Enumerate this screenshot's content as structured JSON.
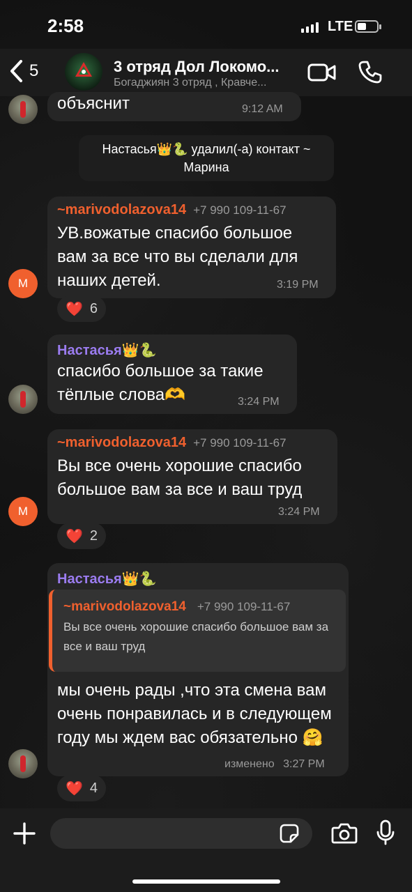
{
  "status": {
    "time": "2:58",
    "network": "LTE"
  },
  "header": {
    "back_count": "5",
    "title": "3 отряд Дол Локомо...",
    "subtitle": "Богаджиян 3 отряд , Кравче..."
  },
  "messages": [
    {
      "text": "объяснит",
      "time": "9:12 AM"
    },
    {
      "system": "Настасья👑🐍 удалил(-а) контакт ~ Марина"
    },
    {
      "sender": "~marivodolazova14",
      "phone": "+7 990 109-11-67",
      "text": "УВ.вожатые спасибо большое вам за все что вы сделали для наших детей.",
      "time": "3:19 PM",
      "avatar_initial": "M",
      "reaction": "6"
    },
    {
      "sender": "Настасья👑🐍",
      "text": "спасибо большое за такие тёплые слова🫶",
      "time": "3:24 PM"
    },
    {
      "sender": "~marivodolazova14",
      "phone": "+7 990 109-11-67",
      "text": "Вы все очень хорошие спасибо большое вам за все и ваш труд",
      "time": "3:24 PM",
      "avatar_initial": "M",
      "reaction": "2"
    },
    {
      "sender": "Настасья👑🐍",
      "quote": {
        "sender": "~marivodolazova14",
        "phone": "+7 990 109-11-67",
        "text": "Вы все очень хорошие спасибо большое вам за все и ваш труд"
      },
      "text": "мы очень рады ,что эта смена вам очень понравилась и в следующем году мы ждем вас обязательно 🤗",
      "edited": "изменено",
      "time": "3:27 PM",
      "reaction": "4"
    }
  ],
  "reaction_emoji": "❤️",
  "input": {
    "placeholder": ""
  },
  "colors": {
    "accent_orange": "#f0602e",
    "accent_purple": "#9b7cf0",
    "bubble": "#262626",
    "background": "#121212"
  },
  "icons": [
    "back-chevron-icon",
    "video-call-icon",
    "phone-icon",
    "plus-icon",
    "sticker-icon",
    "camera-icon",
    "microphone-icon"
  ]
}
